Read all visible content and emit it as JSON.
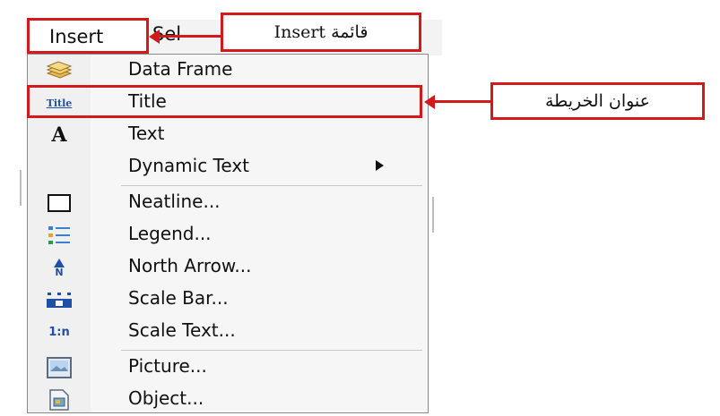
{
  "menubar": {
    "insert_label": "Insert",
    "select_label": "Sel"
  },
  "menu": {
    "items": [
      {
        "label": "Data Frame",
        "icon": "data-frame-icon"
      },
      {
        "label": "Title",
        "icon": "title-icon",
        "icon_text": "Title"
      },
      {
        "label": "Text",
        "icon": "text-icon",
        "icon_text": "A"
      },
      {
        "label": "Dynamic Text",
        "icon": "",
        "has_submenu": true
      },
      {
        "label": "Neatline...",
        "icon": "neatline-icon"
      },
      {
        "label": "Legend...",
        "icon": "legend-icon"
      },
      {
        "label": "North Arrow...",
        "icon": "north-arrow-icon",
        "icon_text": "N"
      },
      {
        "label": "Scale Bar...",
        "icon": "scale-bar-icon"
      },
      {
        "label": "Scale Text...",
        "icon": "scale-text-icon",
        "icon_text": "1:n"
      },
      {
        "label": "Picture...",
        "icon": "picture-icon"
      },
      {
        "label": "Object...",
        "icon": "object-icon"
      }
    ]
  },
  "annotations": {
    "insert_callout": "قائمة Insert",
    "title_callout": "عنوان الخريطة",
    "color": "#d21a1a"
  }
}
